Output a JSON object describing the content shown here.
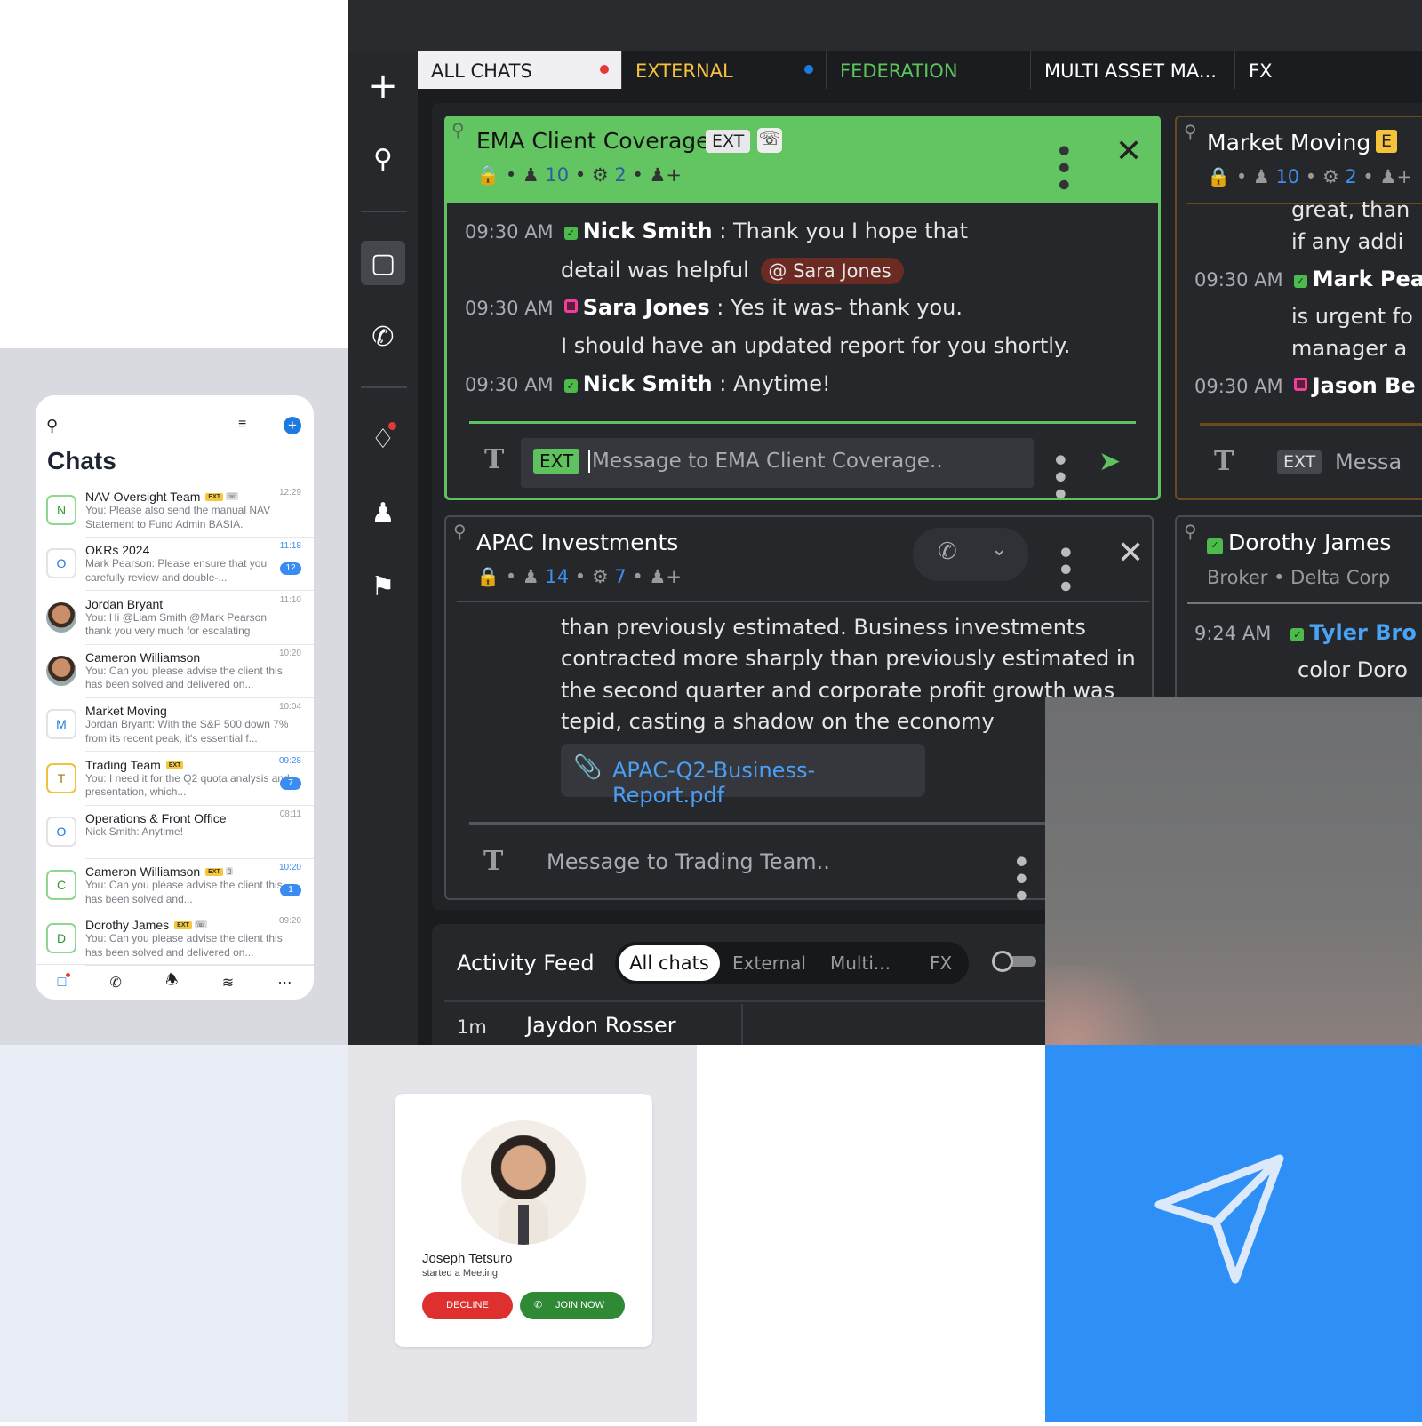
{
  "mobile": {
    "title": "Chats",
    "icons": {
      "search": "search-icon",
      "filter": "filter-icon",
      "add": "plus-circle-icon"
    },
    "items": [
      {
        "initial": "N",
        "name": "NAV Oversight Team",
        "ext": "EXT",
        "channel": "whatsapp",
        "preview": "You: Please also send the manual NAV Statement to Fund Admin BASIA.",
        "time": "12:29",
        "unread": "",
        "border": "#8fd68f",
        "color": "#2d9b2d"
      },
      {
        "initial": "O",
        "name": "OKRs 2024",
        "ext": "",
        "channel": "",
        "preview": "Mark Pearson: Please ensure that you carefully review and double-...",
        "time": "11:18",
        "unread": "12",
        "border": "#e3e3e6",
        "color": "#1f7ae0"
      },
      {
        "initial": "",
        "photo": true,
        "name": "Jordan Bryant",
        "ext": "",
        "channel": "",
        "preview": "You: Hi @Liam Smith @Mark Pearson thank you very much for escalating",
        "time": "11:10",
        "unread": ""
      },
      {
        "initial": "",
        "photo": true,
        "name": "Cameron Williamson",
        "ext": "",
        "channel": "",
        "preview": "You: Can you please advise the client this has been solved and delivered on...",
        "time": "10:20",
        "unread": ""
      },
      {
        "initial": "M",
        "name": "Market Moving",
        "ext": "",
        "channel": "",
        "preview": "Jordan Bryant: With the S&P 500 down 7% from its recent peak, it's essential f...",
        "time": "10:04",
        "unread": "",
        "border": "#e3e3e6",
        "color": "#1f7ae0"
      },
      {
        "initial": "T",
        "name": "Trading Team",
        "ext": "EXT",
        "channel": "",
        "preview": "You: I need it for the Q2 quota analysis and presentation, which...",
        "time": "09:28",
        "unread": "7",
        "border": "#f0c23a",
        "color": "#a07410"
      },
      {
        "initial": "O",
        "name": "Operations & Front Office",
        "ext": "",
        "channel": "",
        "preview": "Nick Smith: Anytime!",
        "time": "08:11",
        "unread": "",
        "border": "#e3e3e6",
        "color": "#1f7ae0"
      },
      {
        "initial": "C",
        "name": "Cameron Williamson",
        "ext": "EXT",
        "channel": "mobile",
        "preview": "You: Can you please advise the client this has been solved and...",
        "time": "10:20",
        "unread": "1",
        "border": "#8fd68f",
        "color": "#2d9b2d"
      },
      {
        "initial": "D",
        "name": "Dorothy James",
        "ext": "EXT",
        "channel": "whatsapp",
        "preview": "You: Can you please advise the client this has been solved and delivered on...",
        "time": "09:20",
        "unread": "",
        "border": "#8fd68f",
        "color": "#2d9b2d"
      }
    ],
    "nav": [
      "chat-icon",
      "phone-icon",
      "bell-icon",
      "feed-icon",
      "more-icon"
    ]
  },
  "app": {
    "tabs": [
      {
        "label": "ALL CHATS",
        "color": "#1b1c1f",
        "bg": "#f0f0f2",
        "dot": "#e53935"
      },
      {
        "label": "EXTERNAL",
        "color": "#f5c33b",
        "bg": "#1b1c1f",
        "dot": "#1f7ae0"
      },
      {
        "label": "FEDERATION",
        "color": "#5cc45c",
        "bg": "#1b1c1f",
        "dot": ""
      },
      {
        "label": "MULTI ASSET MA...",
        "color": "#ffffff",
        "bg": "#1b1c1f",
        "dot": ""
      },
      {
        "label": "FX",
        "color": "#ffffff",
        "bg": "#1b1c1f",
        "dot": ""
      }
    ],
    "ema": {
      "title": "EMA Client Coverage",
      "ext": "EXT",
      "members": "10",
      "bots": "2",
      "messages": [
        {
          "time": "09:30 AM",
          "sender": "Nick Smith",
          "text": "Thank you I hope that",
          "cont": "detail was helpful",
          "mention": "Sara Jones"
        },
        {
          "time": "09:30 AM",
          "sender": "Sara Jones",
          "text": "Yes it was- thank you.",
          "cont": "I should have an updated report for you shortly."
        },
        {
          "time": "09:30 AM",
          "sender": "Nick Smith",
          "text": "Anytime!"
        }
      ],
      "ext_label": "EXT",
      "placeholder": "Message to EMA Client Coverage.."
    },
    "market": {
      "title": "Market Moving",
      "ext": "E",
      "members": "10",
      "bots": "2",
      "lines": [
        "great, than",
        "if any addi"
      ],
      "messages": [
        {
          "time": "09:30 AM",
          "sender": "Mark Pea",
          "cont1": "is urgent fo",
          "cont2": "manager a"
        },
        {
          "time": "09:30 AM",
          "sender": "Jason Be"
        }
      ],
      "ext_label": "EXT",
      "placeholder": "Messa"
    },
    "apac": {
      "title": "APAC Investments",
      "members": "14",
      "bots": "7",
      "lines": [
        "than previously estimated. Business investments",
        "contracted more sharply than previously estimated in",
        "the second quarter and corporate profit growth was",
        "tepid, casting a shadow on the economy"
      ],
      "attachment": "APAC-Q2-Business-Report.pdf",
      "placeholder": "Message to Trading Team.."
    },
    "dorothy": {
      "name": "Dorothy James",
      "role": "Broker",
      "company": "Delta Corp",
      "time": "9:24 AM",
      "sender": "Tyler Bro",
      "cont": "color Doro"
    },
    "activity": {
      "title": "Activity Feed",
      "filters": [
        "All chats",
        "External",
        "Multi...",
        "FX"
      ],
      "row": {
        "age": "1m",
        "name": "Jaydon Rosser"
      }
    }
  },
  "meeting": {
    "name": "Joseph Tetsuro",
    "status": "started a Meeting",
    "decline": "DECLINE",
    "join": "JOIN NOW"
  }
}
